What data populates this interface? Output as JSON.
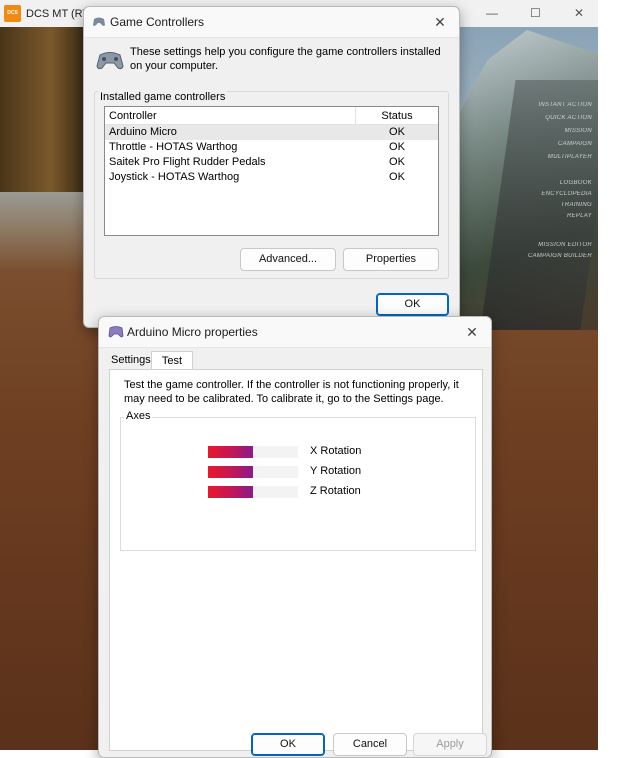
{
  "background_app": {
    "logo_text": "DCS",
    "title": "DCS MT (RT",
    "menu_items": [
      "INSTANT ACTION",
      "QUICK ACTION",
      "MISSION",
      "CAMPAIGN",
      "MULTIPLAYER",
      "LOGBOOK",
      "ENCYCLOPEDIA",
      "TRAINING",
      "REPLAY",
      "MISSION EDITOR",
      "CAMPAIGN BUILDER"
    ],
    "controls": {
      "minimize": "—",
      "maximize": "☐",
      "close": "✕"
    }
  },
  "game_controllers": {
    "title": "Game Controllers",
    "description": "These settings help you configure the game controllers installed on your computer.",
    "group_label": "Installed game controllers",
    "columns": {
      "controller": "Controller",
      "status": "Status"
    },
    "rows": [
      {
        "name": "Arduino Micro",
        "status": "OK",
        "selected": true
      },
      {
        "name": "Throttle - HOTAS Warthog",
        "status": "OK",
        "selected": false
      },
      {
        "name": "Saitek Pro Flight Rudder Pedals",
        "status": "OK",
        "selected": false
      },
      {
        "name": "Joystick - HOTAS Warthog",
        "status": "OK",
        "selected": false
      }
    ],
    "buttons": {
      "advanced": "Advanced...",
      "properties": "Properties",
      "ok": "OK"
    },
    "close_glyph": "✕"
  },
  "properties_dialog": {
    "title": "Arduino Micro properties",
    "tabs": {
      "settings": "Settings",
      "test": "Test"
    },
    "active_tab": "Test",
    "description": "Test the game controller.  If the controller is not functioning properly, it may need to be calibrated.  To calibrate it, go to the Settings page.",
    "axes_label": "Axes",
    "axes": [
      {
        "label": "X Rotation",
        "level": 0.5
      },
      {
        "label": "Y Rotation",
        "level": 0.5
      },
      {
        "label": "Z Rotation",
        "level": 0.5
      }
    ],
    "buttons": {
      "ok": "OK",
      "cancel": "Cancel",
      "apply": "Apply"
    },
    "close_glyph": "✕"
  },
  "colors": {
    "accent": "#0067c0",
    "axis_fill_start": "#e8192c",
    "axis_fill_end": "#8a1a8c"
  }
}
